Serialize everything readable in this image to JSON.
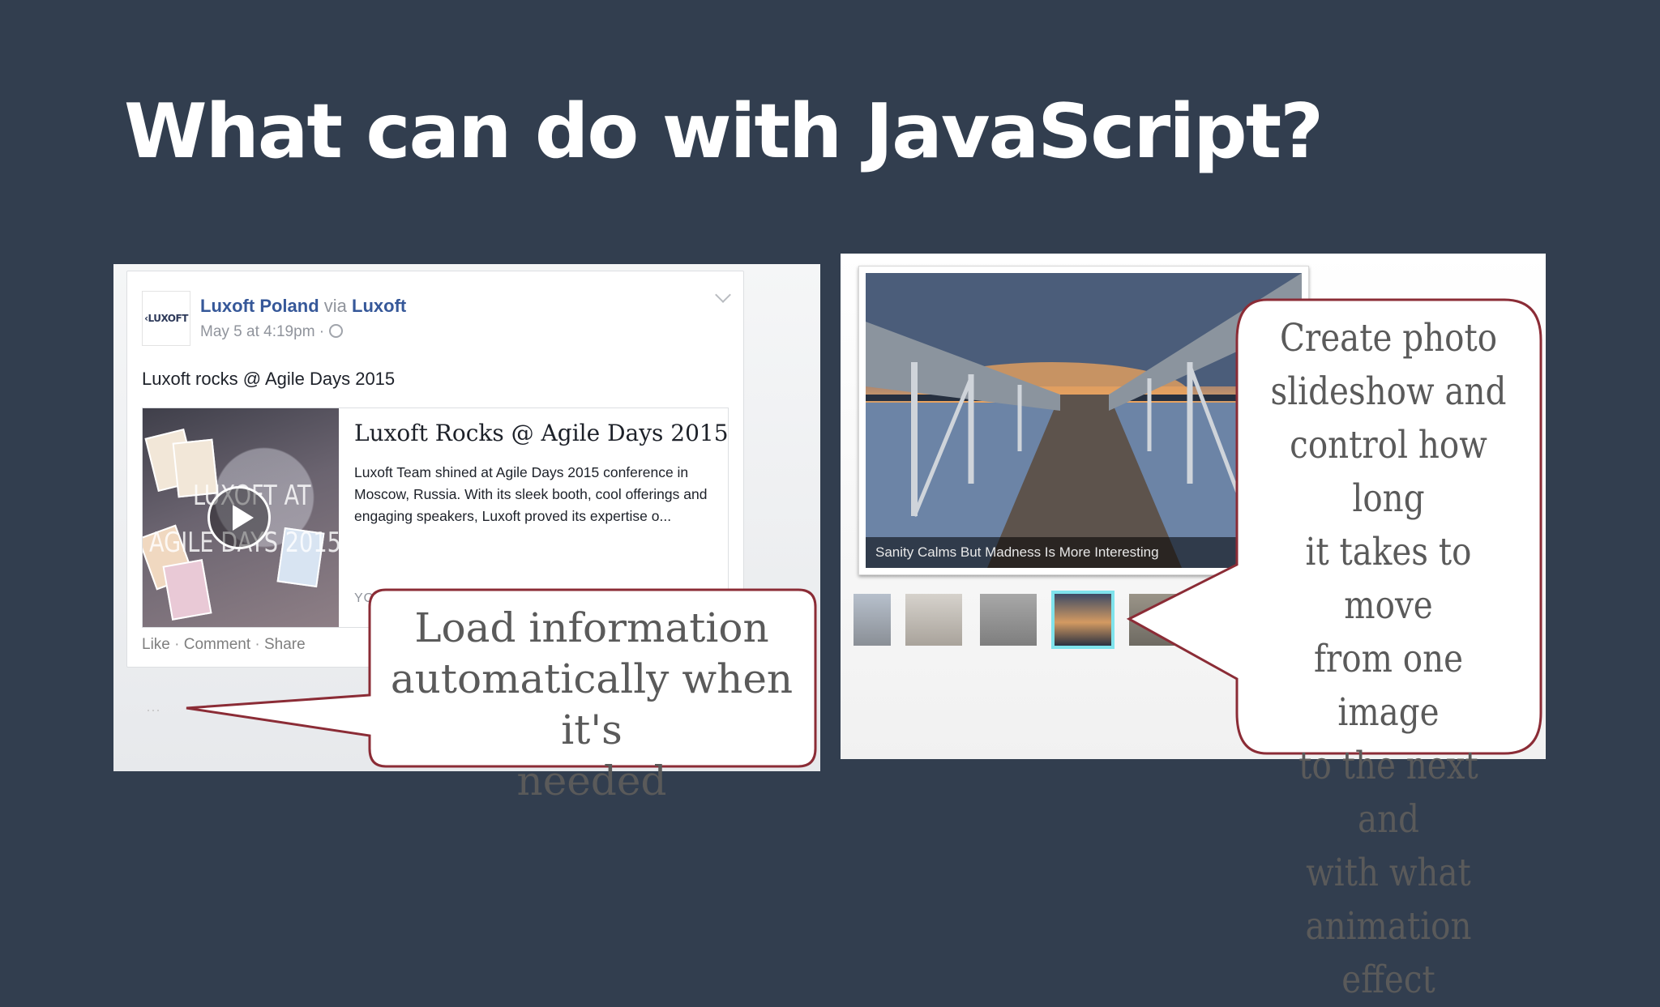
{
  "slide": {
    "title": "What can do with JavaScript?"
  },
  "facebook_post": {
    "logo_text": "‹LUXOFT",
    "author": "Luxoft Poland",
    "via_word": "via",
    "via_page": "Luxoft",
    "timestamp": "May 5 at 4:19pm ·",
    "status": "Luxoft rocks @ Agile Days 2015",
    "link_title": "Luxoft Rocks @ Agile Days 2015",
    "link_description": "Luxoft Team shined at Agile Days 2015 conference in Moscow, Russia. With its sleek booth, cool offerings and engaging speakers, Luxoft proved its expertise o...",
    "link_source": "YOUTUBE.COM",
    "thumbnail_text_1": "LUXOFT AT",
    "thumbnail_text_2": "AGILE DAYS 2015",
    "actions": {
      "like": "Like",
      "comment": "Comment",
      "share": "Share",
      "separator": "·"
    },
    "loading_dots": "···",
    "icons": [
      "globe-icon",
      "chevron-down-icon",
      "play-icon"
    ]
  },
  "callout_left": {
    "lines": [
      "Load information",
      "automatically when it's",
      "needed"
    ]
  },
  "slideshow": {
    "caption": "Sanity Calms But Madness Is More Interesting",
    "thumbnail_count": 5,
    "active_thumbnail": 4,
    "accent_color": "#7fe3ec"
  },
  "callout_right": {
    "lines": [
      "Create photo",
      "slideshow and",
      "control how long",
      "it takes to move",
      "from one image",
      "to the next and",
      "with what",
      "animation effect"
    ]
  },
  "colors": {
    "background": "#323e4f",
    "callout_border": "#8b2c36",
    "link_blue": "#365899"
  }
}
